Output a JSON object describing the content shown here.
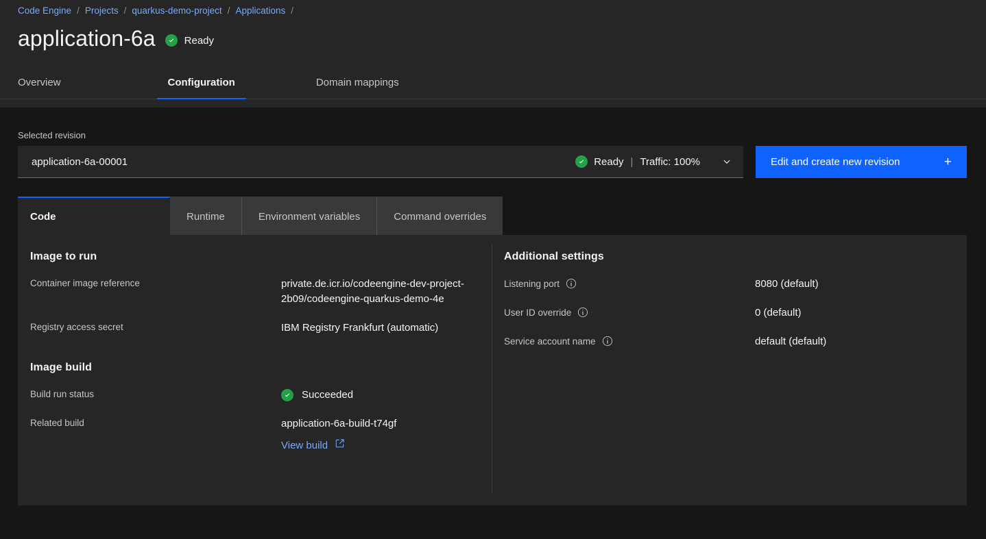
{
  "breadcrumb": {
    "items": [
      {
        "label": "Code Engine"
      },
      {
        "label": "Projects"
      },
      {
        "label": "quarkus-demo-project"
      },
      {
        "label": "Applications"
      }
    ],
    "separator": "/"
  },
  "header": {
    "title": "application-6a",
    "status": "Ready"
  },
  "tabs": [
    {
      "label": "Overview",
      "active": false
    },
    {
      "label": "Configuration",
      "active": true
    },
    {
      "label": "Domain mappings",
      "active": false
    }
  ],
  "revision": {
    "label": "Selected revision",
    "name": "application-6a-00001",
    "status": "Ready",
    "divider": "|",
    "traffic": "Traffic: 100%",
    "chevron_icon": "chevron-down-icon",
    "edit_button": "Edit and create new revision",
    "edit_button_plus": "+"
  },
  "sub_tabs": [
    {
      "label": "Code",
      "active": true
    },
    {
      "label": "Runtime",
      "active": false
    },
    {
      "label": "Environment variables",
      "active": false
    },
    {
      "label": "Command overrides",
      "active": false
    }
  ],
  "left_panel": {
    "image_to_run": {
      "title": "Image to run",
      "rows": [
        {
          "key": "Container image reference",
          "value": "private.de.icr.io/codeengine-dev-project-2b09/codeengine-quarkus-demo-4e"
        },
        {
          "key": "Registry access secret",
          "value": "IBM Registry Frankfurt (automatic)"
        }
      ]
    },
    "image_build": {
      "title": "Image build",
      "status_row": {
        "key": "Build run status",
        "value": "Succeeded"
      },
      "related_row": {
        "key": "Related build",
        "value": "application-6a-build-t74gf"
      },
      "view_build_link": "View build",
      "view_build_icon": "external-link-icon"
    }
  },
  "right_panel": {
    "title": "Additional settings",
    "rows": [
      {
        "key": "Listening port",
        "value": "8080 (default)",
        "info_icon": "info-icon"
      },
      {
        "key": "User ID override",
        "value": "0 (default)",
        "info_icon": "info-icon"
      },
      {
        "key": "Service account name",
        "value": "default (default)",
        "info_icon": "info-icon"
      }
    ]
  },
  "colors": {
    "accent": "#0f62fe",
    "link": "#78a9ff",
    "success": "#24a148",
    "panel_bg": "#262626",
    "page_bg": "#161616",
    "tab_inactive_bg": "#393939"
  }
}
